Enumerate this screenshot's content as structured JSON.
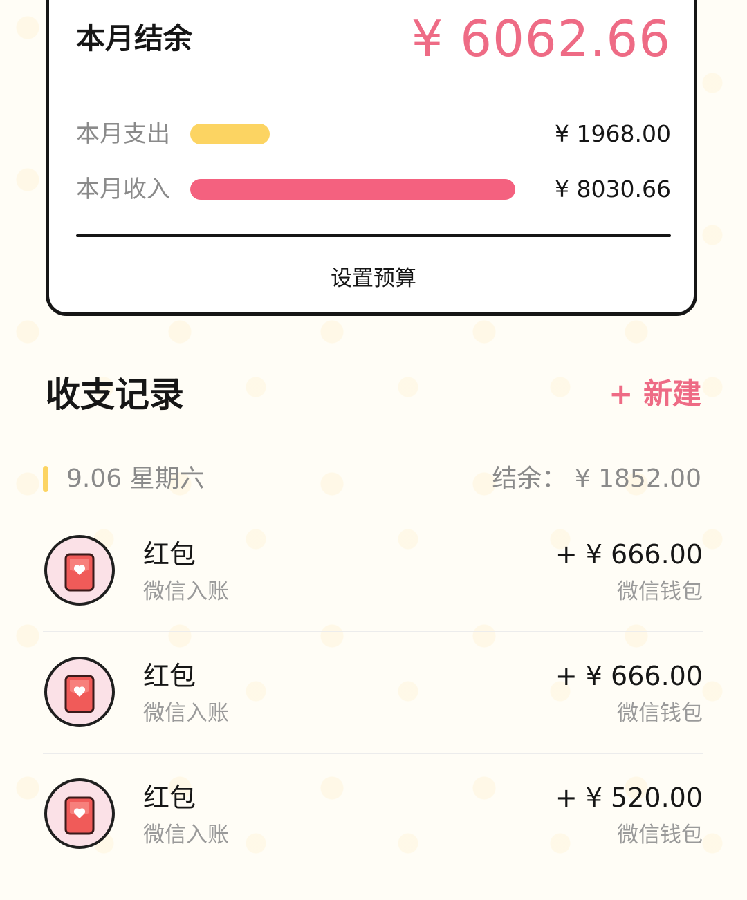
{
  "summary": {
    "balance_label": "本月结余",
    "balance_value": "¥ 6062.66",
    "balance_color": "#ee6b85",
    "expense": {
      "label": "本月支出",
      "amount": "¥ 1968.00",
      "bar_fraction": 0.245,
      "color": "#fcd462"
    },
    "income": {
      "label": "本月收入",
      "amount": "¥ 8030.66",
      "bar_fraction": 1.0,
      "color": "#f4617f"
    },
    "budget_button": "设置预算"
  },
  "records": {
    "title": "收支记录",
    "new_button": "+ 新建",
    "accent_color": "#ee6b85",
    "day": {
      "date": "9.06 星期六",
      "balance": "结余：  ¥ 1852.00",
      "marker_color": "#fcd462"
    },
    "items": [
      {
        "icon": "red-envelope-icon",
        "title": "红包",
        "subtitle": "微信入账",
        "amount": "+ ¥ 666.00",
        "account": "微信钱包"
      },
      {
        "icon": "red-envelope-icon",
        "title": "红包",
        "subtitle": "微信入账",
        "amount": "+ ¥ 666.00",
        "account": "微信钱包"
      },
      {
        "icon": "red-envelope-icon",
        "title": "红包",
        "subtitle": "微信入账",
        "amount": "+ ¥ 520.00",
        "account": "微信钱包"
      }
    ]
  }
}
